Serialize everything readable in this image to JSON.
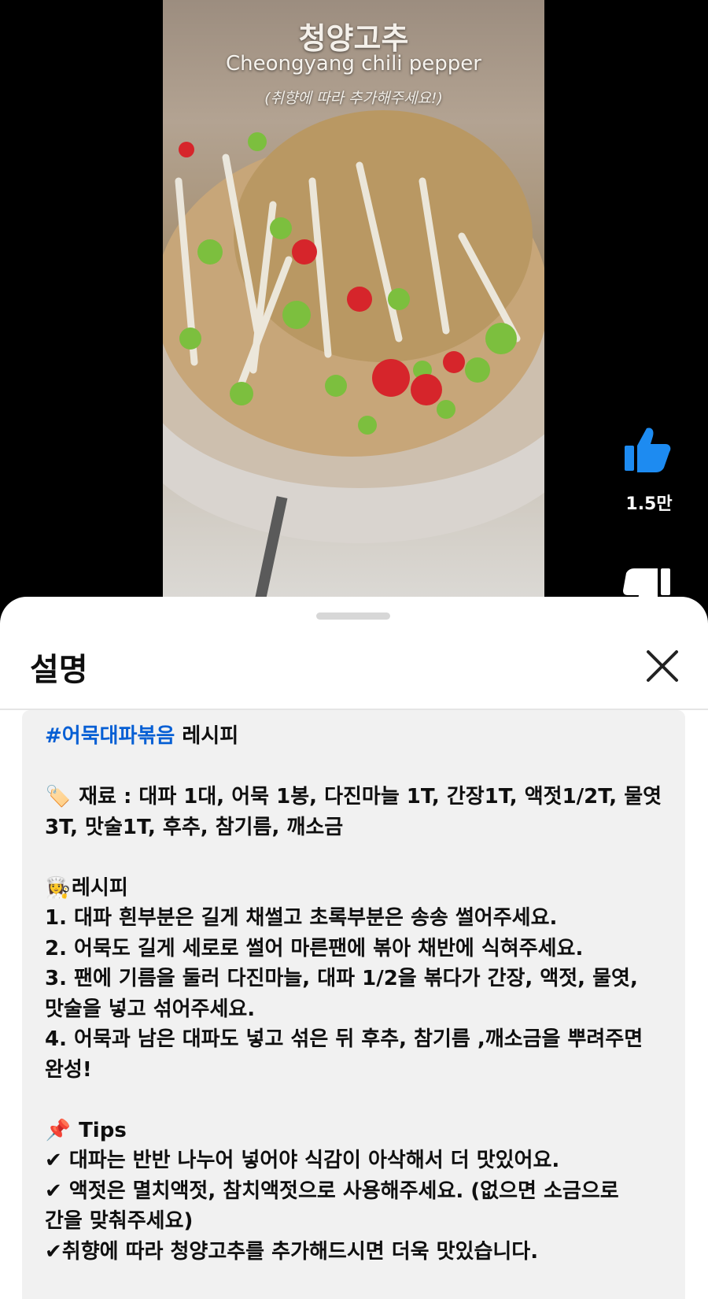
{
  "video": {
    "overlay_title_ko": "청양고추",
    "overlay_title_en": "Cheongyang chili pepper",
    "overlay_note": "(취향에 따라 추가해주세요!)"
  },
  "actions": {
    "like_count": "1.5만",
    "like_icon": "thumbs-up-icon",
    "dislike_icon": "thumbs-down-icon"
  },
  "sheet": {
    "title": "설명",
    "close_icon": "close-icon"
  },
  "description": {
    "hashtag": "#어묵대파볶음",
    "headline_rest": " 레시피",
    "ingredients_emoji": "🏷️",
    "ingredients_line1": "재료 : 대파 1대, 어묵 1봉, 다진마늘 1T, 간장1T, 액젓1/2T, 물엿",
    "ingredients_line2": "3T, 맛술1T, 후추, 참기름, 깨소금",
    "recipe_emoji": "👩‍🍳",
    "recipe_heading": "레시피",
    "steps": [
      "1. 대파 흰부분은 길게 채썰고 초록부분은 송송 썰어주세요.",
      "2. 어묵도 길게 세로로 썰어 마른팬에 볶아 채반에 식혀주세요.",
      "3. 팬에 기름을 둘러 다진마늘, 대파 1/2을 볶다가 간장, 액젓, 물엿,",
      "맛술을 넣고 섞어주세요.",
      "4. 어묵과 남은 대파도 넣고 섞은 뒤 후추, 참기름 ,깨소금을 뿌려주면",
      "완성!"
    ],
    "tips_emoji": "📌",
    "tips_heading": "Tips",
    "check": "✔",
    "tips": [
      " 대파는 반반 나누어 넣어야 식감이 아삭해서 더 맛있어요.",
      " 액젓은 멸치액젓, 참치액젓으로 사용해주세요. (없으면 소금으로",
      "간을 맞춰주세요)",
      "취향에 따라 청양고추를 추가해드시면 더욱 맛있습니다."
    ]
  },
  "colors": {
    "hashtag": "#065fd4",
    "like_blue": "#1d8bf1",
    "desc_bg": "#f1f1f1"
  }
}
